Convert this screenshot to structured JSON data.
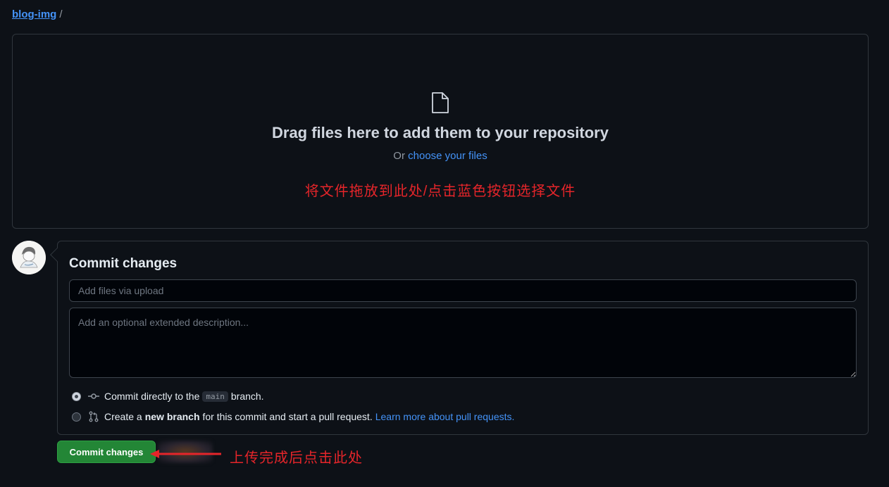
{
  "breadcrumb": {
    "repo": "blog-img",
    "separator": "/"
  },
  "dropzone": {
    "icon": "file-icon",
    "title": "Drag files here to add them to your repository",
    "sub_prefix": "Or",
    "sub_link": "choose your files",
    "annotation": "将文件拖放到此处/点击蓝色按钮选择文件"
  },
  "commit": {
    "title": "Commit changes",
    "summary_placeholder": "Add files via upload",
    "description_placeholder": "Add an optional extended description...",
    "option_direct": {
      "prefix": "Commit directly to the",
      "branch": "main",
      "suffix": "branch.",
      "selected": true
    },
    "option_new": {
      "prefix": "Create a",
      "bold": "new branch",
      "middle": "for this commit and start a pull request.",
      "link": "Learn more about pull requests.",
      "selected": false
    },
    "button_label": "Commit changes",
    "annotation": "上传完成后点击此处"
  },
  "colors": {
    "accent": "#4493f8",
    "button": "#238636",
    "annotation": "#e5252a",
    "background": "#0d1117"
  }
}
